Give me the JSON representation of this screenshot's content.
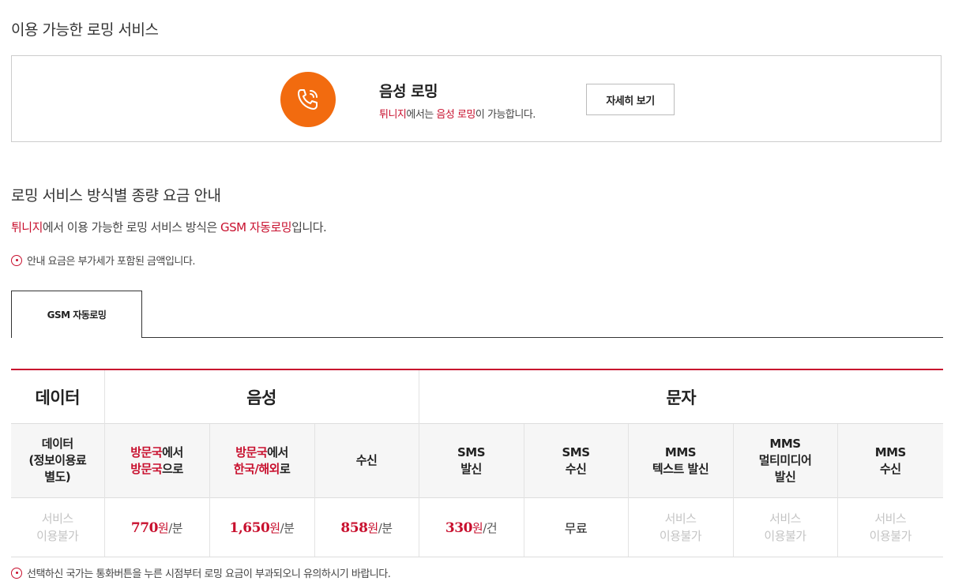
{
  "available_service": {
    "section_title": "이용 가능한 로밍 서비스",
    "service_name": "음성 로밍",
    "desc": {
      "country": "튀니지",
      "mid": "에서는 ",
      "service": "음성 로밍",
      "suffix": "이 가능합니다."
    },
    "detail_button": "자세히 보기",
    "icon": "phone-calling-icon",
    "icon_color": "#f26b0f"
  },
  "rates_section": {
    "section_title": "로밍 서비스 방식별 종량 요금 안내",
    "intro": {
      "country": "튀니지",
      "mid": "에서 이용 가능한 로밍 서비스 방식은 ",
      "method": "GSM 자동로밍",
      "suffix": "입니다."
    },
    "vat_note": "안내 요금은 부가세가 포함된 금액입니다.",
    "tabs": [
      {
        "label": "GSM 자동로밍"
      }
    ],
    "accent_color": "#c8102e"
  },
  "table": {
    "groups": [
      "데이터",
      "음성",
      "문자"
    ],
    "columns": {
      "data": {
        "l1": "데이터",
        "l2": "(정보이용료",
        "l3": "별도)"
      },
      "voice_local": {
        "l1a": "방문국",
        "l1b": "에서",
        "l2a": "방문국",
        "l2b": "으로"
      },
      "voice_intl": {
        "l1a": "방문국",
        "l1b": "에서",
        "l2a": "한국/해외",
        "l2b": "로"
      },
      "receive": "수신",
      "sms_send": {
        "l1": "SMS",
        "l2": "발신"
      },
      "sms_recv": {
        "l1": "SMS",
        "l2": "수신"
      },
      "mms_text": {
        "l1": "MMS",
        "l2": "텍스트 발신"
      },
      "mms_multi": {
        "l1": "MMS",
        "l2": "멀티미디어",
        "l3": "발신"
      },
      "mms_recv": {
        "l1": "MMS",
        "l2": "수신"
      }
    },
    "values": {
      "na_l1": "서비스",
      "na_l2": "이용불가",
      "voice_local": {
        "price": "770",
        "won": "원",
        "unit": "/분"
      },
      "voice_intl": {
        "price": "1,650",
        "won": "원",
        "unit": "/분"
      },
      "receive": {
        "price": "858",
        "won": "원",
        "unit": "/분"
      },
      "sms_send": {
        "price": "330",
        "won": "원",
        "unit": "/건"
      },
      "sms_recv": "무료"
    }
  },
  "footer_note": "선택하신 국가는 통화버튼을 누른 시점부터 로밍 요금이 부과되오니 유의하시기 바랍니다."
}
